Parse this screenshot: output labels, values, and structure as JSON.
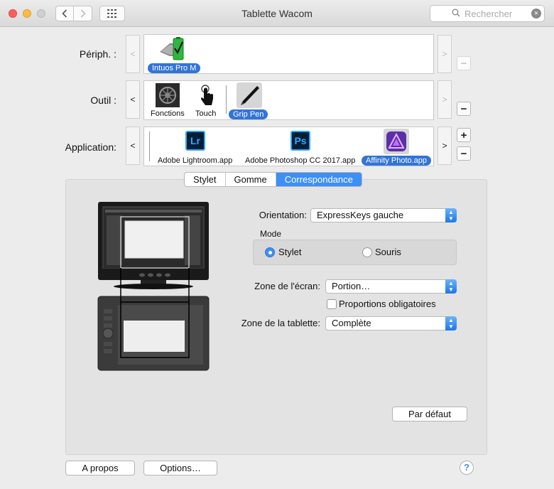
{
  "window": {
    "title": "Tablette Wacom"
  },
  "search": {
    "placeholder": "Rechercher",
    "icon": "magnifier-icon"
  },
  "rows": {
    "device": {
      "label": "Périph. :",
      "items": [
        {
          "label": "Intuos Pro M",
          "selected": true
        }
      ]
    },
    "tool": {
      "label": "Outil :",
      "items": [
        {
          "label": "Fonctions"
        },
        {
          "label": "Touch"
        },
        {
          "label": "Grip Pen",
          "selected": true
        }
      ]
    },
    "application": {
      "label": "Application:",
      "items": [
        {
          "label": "Adobe Lightroom.app",
          "icon_text": "Lr"
        },
        {
          "label": "Adobe Photoshop CC 2017.app",
          "icon_text": "Ps"
        },
        {
          "label": "Affinity Photo.app",
          "selected": true
        }
      ]
    }
  },
  "glyphs": {
    "prev": "<",
    "next": ">",
    "plus": "+",
    "minus": "−"
  },
  "tabs": [
    {
      "label": "Stylet"
    },
    {
      "label": "Gomme"
    },
    {
      "label": "Correspondance",
      "active": true
    }
  ],
  "mapping": {
    "orientation_label": "Orientation:",
    "orientation_value": "ExpressKeys gauche",
    "mode_label": "Mode",
    "mode_options": [
      {
        "label": "Stylet",
        "checked": true
      },
      {
        "label": "Souris",
        "checked": false
      }
    ],
    "screen_area_label": "Zone de l'écran:",
    "screen_area_value": "Portion…",
    "proportions_label": "Proportions obligatoires",
    "proportions_checked": false,
    "tablet_area_label": "Zone de la tablette:",
    "tablet_area_value": "Complète",
    "default_button": "Par défaut"
  },
  "footer": {
    "about_button": "A propos",
    "options_button": "Options…",
    "help": "?"
  },
  "colors": {
    "accent": "#3d8ff6",
    "selection": "#3274d8",
    "lightroom": "#001e36",
    "photoshop": "#001e36",
    "affinity": "#7e4dd2"
  }
}
